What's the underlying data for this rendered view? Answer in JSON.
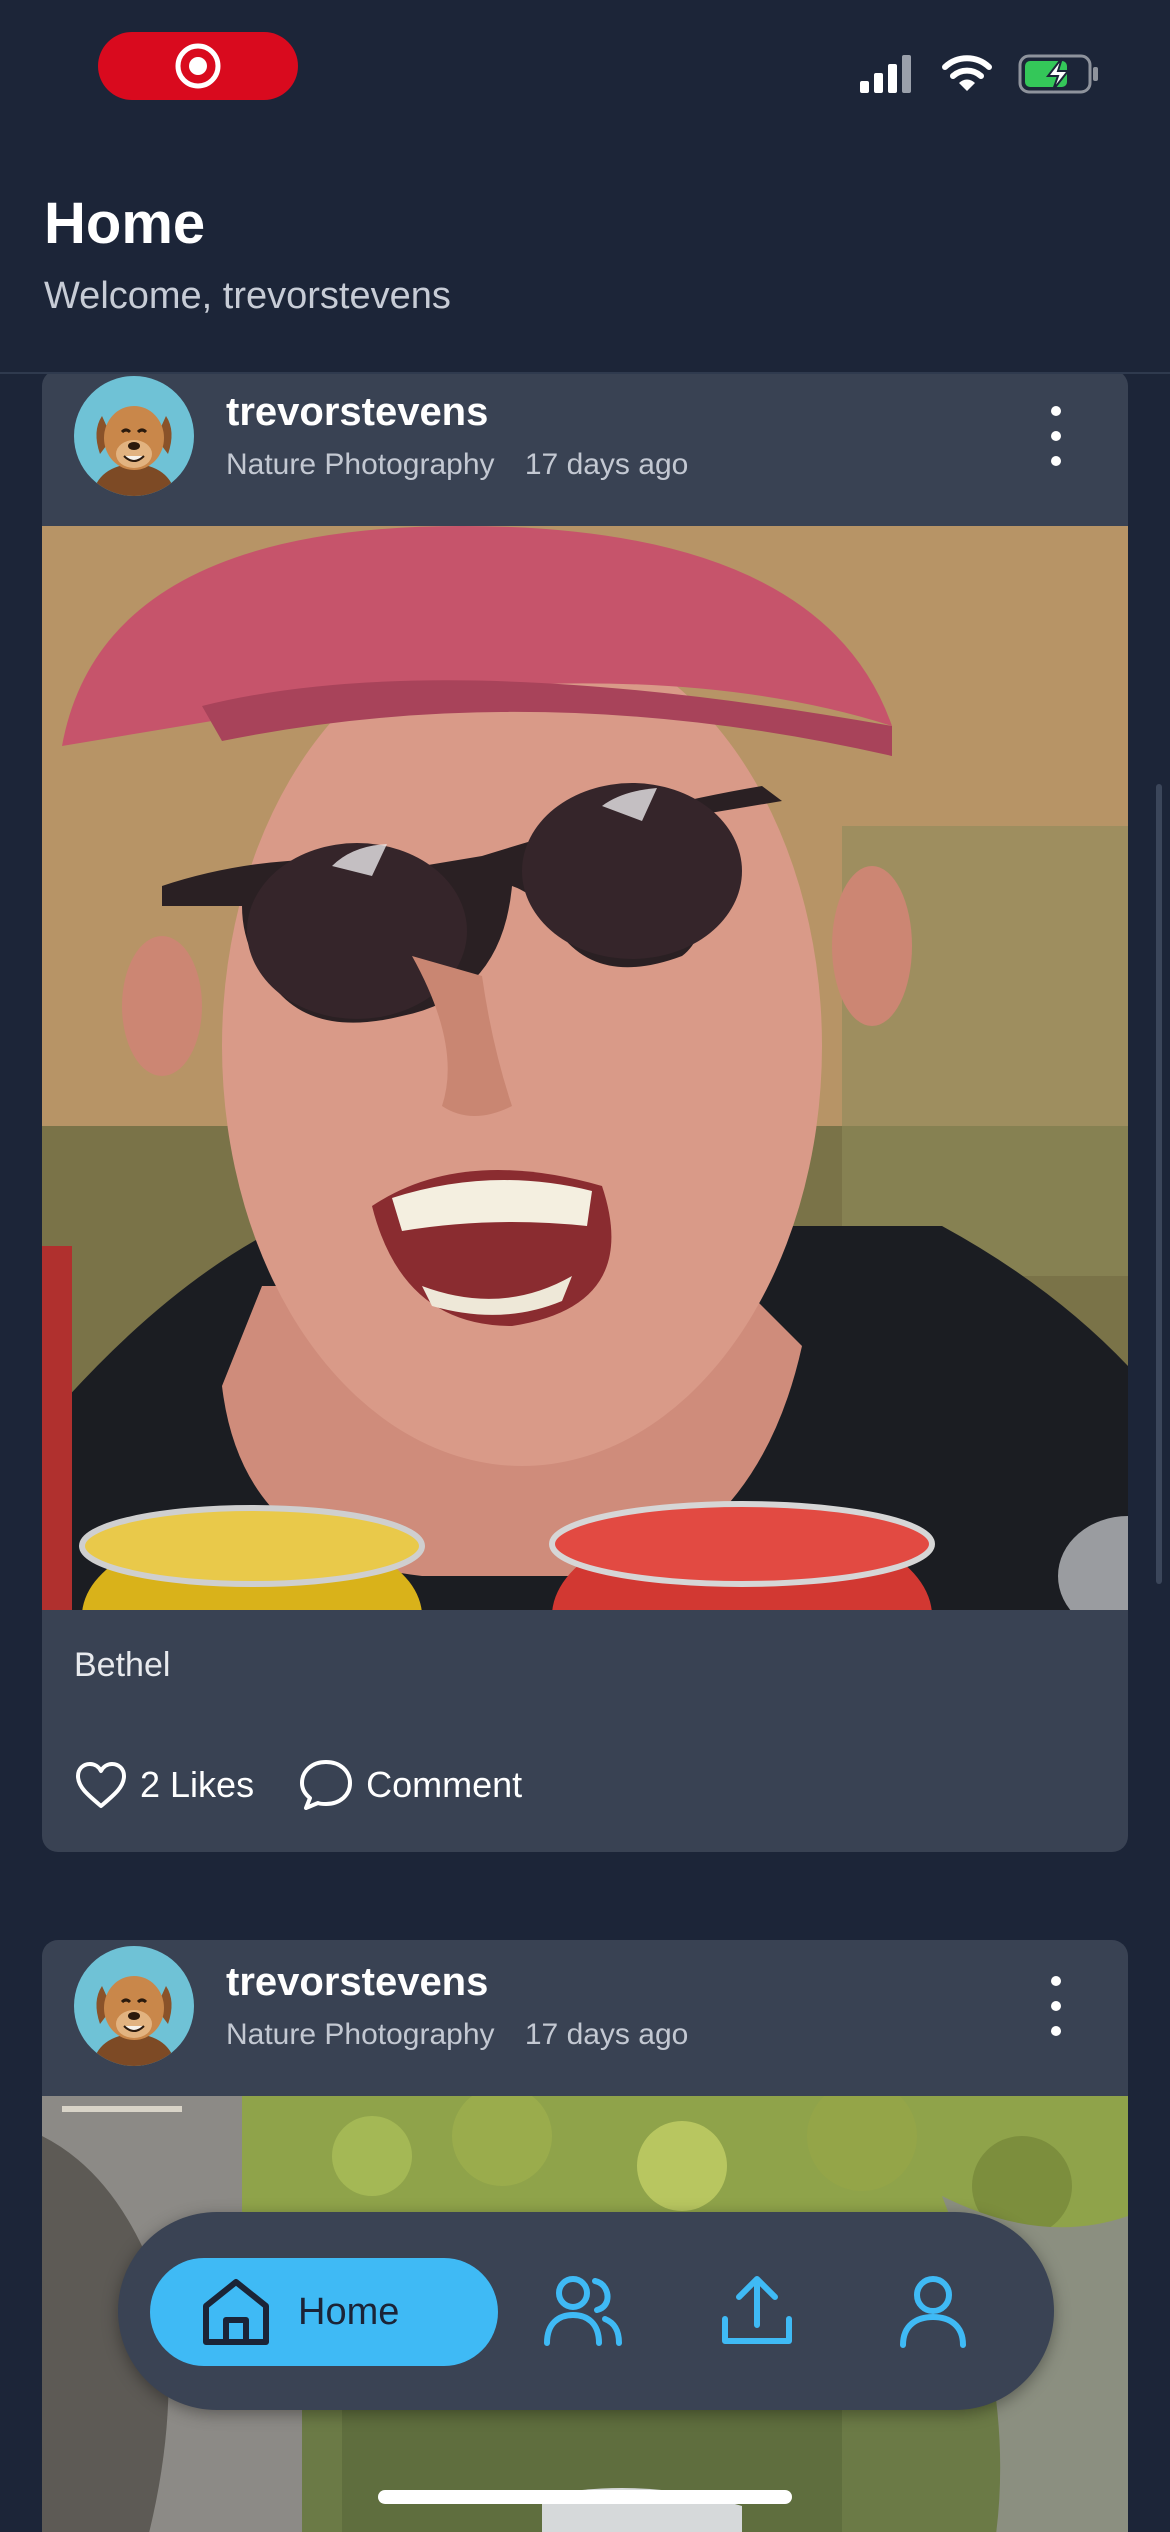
{
  "header": {
    "title": "Home",
    "subtitle": "Welcome, trevorstevens"
  },
  "posts": [
    {
      "username": "trevorstevens",
      "category": "Nature Photography",
      "time": "17 days ago",
      "caption": "Bethel",
      "likes_label": "2 Likes",
      "comment_label": "Comment"
    },
    {
      "username": "trevorstevens",
      "category": "Nature Photography",
      "time": "17 days ago"
    }
  ],
  "tab_bar": {
    "items": [
      {
        "label": "Home",
        "icon": "home-icon",
        "active": true
      },
      {
        "label": "",
        "icon": "friends-icon"
      },
      {
        "label": "",
        "icon": "upload-icon"
      },
      {
        "label": "",
        "icon": "profile-icon"
      }
    ]
  },
  "colors": {
    "background": "#1c2538",
    "card": "#394253",
    "accent": "#3fbaf5",
    "recording": "#d90a1e",
    "battery": "#34c759"
  }
}
